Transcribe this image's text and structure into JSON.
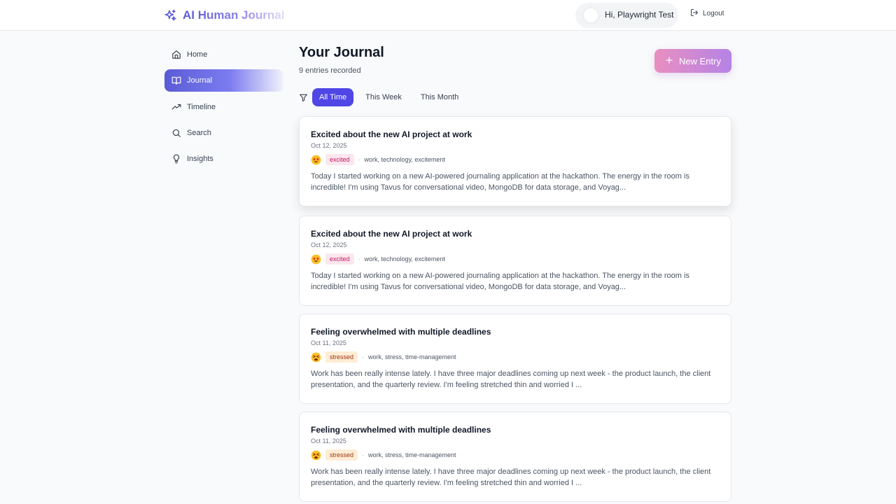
{
  "app": {
    "title": "AI Human Journal"
  },
  "header": {
    "greeting": "Hi, Playwright Test",
    "logout_label": "Logout"
  },
  "sidebar": {
    "items": [
      {
        "label": "Home",
        "icon": "home-icon"
      },
      {
        "label": "Journal",
        "icon": "book-open-icon",
        "active": true
      },
      {
        "label": "Timeline",
        "icon": "trending-up-icon"
      },
      {
        "label": "Search",
        "icon": "search-icon"
      },
      {
        "label": "Insights",
        "icon": "lightbulb-icon"
      }
    ]
  },
  "main": {
    "title": "Your Journal",
    "subtitle": "9 entries recorded",
    "new_entry_label": "New Entry",
    "filters": [
      {
        "label": "All Time",
        "active": true
      },
      {
        "label": "This Week"
      },
      {
        "label": "This Month"
      }
    ],
    "entries": [
      {
        "title": "Excited about the new AI project at work",
        "date": "Oct 12, 2025",
        "emoji": "star-struck",
        "mood": "excited",
        "tags": "work, technology, excitement",
        "excerpt": "Today I started working on a new AI-powered journaling application at the hackathon. The energy in the room is incredible! I'm using Tavus for conversational video, MongoDB for data storage, and Voyag..."
      },
      {
        "title": "Excited about the new AI project at work",
        "date": "Oct 12, 2025",
        "emoji": "star-struck",
        "mood": "excited",
        "tags": "work, technology, excitement",
        "excerpt": "Today I started working on a new AI-powered journaling application at the hackathon. The energy in the room is incredible! I'm using Tavus for conversational video, MongoDB for data storage, and Voyag..."
      },
      {
        "title": "Feeling overwhelmed with multiple deadlines",
        "date": "Oct 11, 2025",
        "emoji": "tired-face",
        "mood": "stressed",
        "tags": "work, stress, time-management",
        "excerpt": "Work has been really intense lately. I have three major deadlines coming up next week - the product launch, the client presentation, and the quarterly review. I'm feeling stretched thin and worried I ..."
      },
      {
        "title": "Feeling overwhelmed with multiple deadlines",
        "date": "Oct 11, 2025",
        "emoji": "tired-face",
        "mood": "stressed",
        "tags": "work, stress, time-management",
        "excerpt": "Work has been really intense lately. I have three major deadlines coming up next week - the product launch, the client presentation, and the quarterly review. I'm feeling stretched thin and worried I ..."
      }
    ]
  },
  "colors": {
    "accent": "#4f46e5",
    "excited_bg": "#fce7ef",
    "stressed_bg": "#ffedd5"
  }
}
